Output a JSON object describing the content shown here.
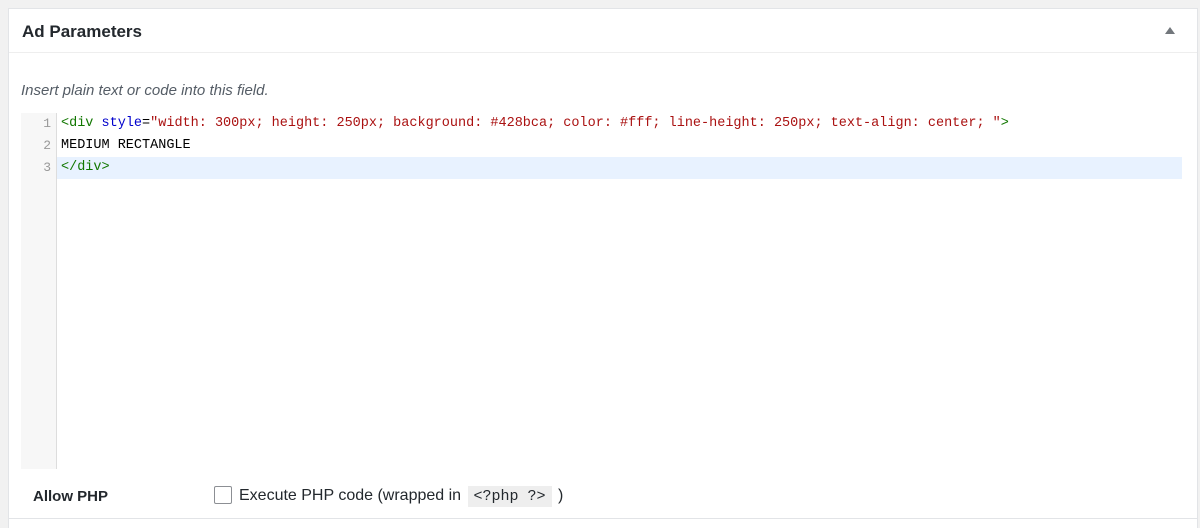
{
  "metabox": {
    "title": "Ad Parameters",
    "toggle_icon": "triangle-up-icon"
  },
  "editor": {
    "help_text": "Insert plain text or code into this field.",
    "line_numbers": [
      "1",
      "2",
      "3"
    ],
    "lines": [
      {
        "tag_open": "<div",
        "attr_name": "style",
        "equals": "=",
        "attr_value": "\"width: 300px; height: 250px; background: #428bca; color: #fff; line-height: 250px; text-align: center; \"",
        "tag_close": ">"
      },
      {
        "text": "MEDIUM RECTANGLE"
      },
      {
        "tag": "</div>"
      }
    ],
    "active_line": 3
  },
  "settings": {
    "allow_php_label": "Allow PHP",
    "checkbox_checked": false,
    "checkbox_label_prefix": "Execute PHP code (wrapped in",
    "checkbox_code": "<?php ?>",
    "checkbox_label_suffix": ")"
  },
  "colors": {
    "tag": "#117700",
    "attribute": "#0000cc",
    "string": "#aa1111",
    "active_line_bg": "#e8f2ff"
  }
}
